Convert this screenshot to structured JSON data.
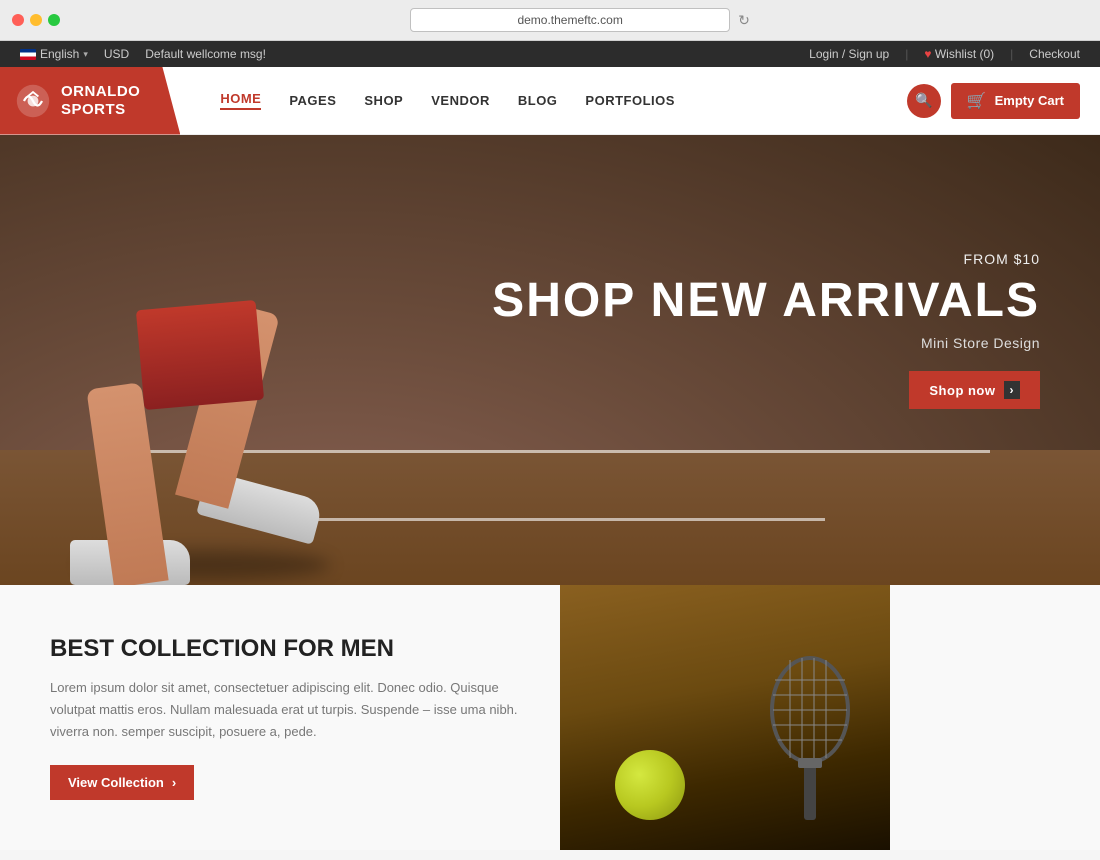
{
  "browser": {
    "url": "demo.themeftc.com",
    "dots": [
      "red",
      "yellow",
      "green"
    ]
  },
  "topbar": {
    "language": "English",
    "currency": "USD",
    "welcome": "Default wellcome msg!",
    "login": "Login / Sign up",
    "wishlist": "Wishlist (0)",
    "checkout": "Checkout"
  },
  "nav": {
    "logo_line1": "ORNALDO",
    "logo_line2": "SPORTS",
    "links": [
      "HOME",
      "PAGES",
      "SHOP",
      "VENDOR",
      "BLOG",
      "PORTFOLIOS"
    ],
    "active_link": "HOME",
    "cart_label": "Empty Cart"
  },
  "hero": {
    "from_text": "FROM $10",
    "title": "SHOP NEW ARRIVALS",
    "subtitle": "Mini Store Design",
    "cta_label": "Shop now"
  },
  "collection": {
    "title": "BEST COLLECTION FOR MEN",
    "description": "Lorem ipsum dolor sit amet, consectetuer adipiscing elit. Donec odio. Quisque volutpat mattis eros. Nullam malesuada erat ut turpis. Suspende – isse uma nibh. viverra non. semper suscipit, posuere a, pede.",
    "cta_label": "View Collection"
  }
}
